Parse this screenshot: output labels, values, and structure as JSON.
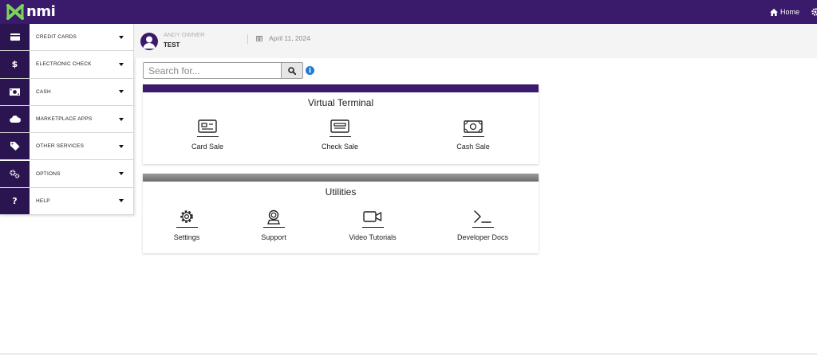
{
  "brand": {
    "name": "nmi",
    "color_primary": "#3a1a6b",
    "color_sidebar_icon": "#2b1550"
  },
  "topbar": {
    "home_label": "Home",
    "home_icon": "home-icon",
    "settings_icon": "gear-icon"
  },
  "sidebar": {
    "items": [
      {
        "label": "CREDIT CARDS",
        "icon": "credit-card-icon"
      },
      {
        "label": "ELECTRONIC CHECK",
        "icon": "dollar-icon"
      },
      {
        "label": "CASH",
        "icon": "cash-icon"
      },
      {
        "label": "MARKETPLACE APPS",
        "icon": "cloud-icon"
      },
      {
        "label": "OTHER SERVICES",
        "icon": "tags-icon"
      },
      {
        "label": "OPTIONS",
        "icon": "cogs-icon"
      },
      {
        "label": "HELP",
        "icon": "question-icon"
      }
    ]
  },
  "header": {
    "user_name": "ANDY OWNER",
    "account": "TEST",
    "date": "April 11, 2024",
    "date_icon": "calendar-icon"
  },
  "search": {
    "placeholder": "Search for...",
    "value": "",
    "button_icon": "search-icon",
    "info_icon": "info-icon"
  },
  "virtual_terminal": {
    "title": "Virtual Terminal",
    "bar_color": "#3a1a6b",
    "tiles": [
      {
        "label": "Card Sale",
        "icon": "card-sale-icon"
      },
      {
        "label": "Check Sale",
        "icon": "check-sale-icon"
      },
      {
        "label": "Cash Sale",
        "icon": "cash-sale-icon"
      }
    ]
  },
  "utilities": {
    "title": "Utilities",
    "bar_color": "#8a8a8a",
    "tiles": [
      {
        "label": "Settings",
        "icon": "settings-icon"
      },
      {
        "label": "Support",
        "icon": "support-icon"
      },
      {
        "label": "Video Tutorials",
        "icon": "video-icon"
      },
      {
        "label": "Developer Docs",
        "icon": "terminal-icon"
      }
    ]
  }
}
